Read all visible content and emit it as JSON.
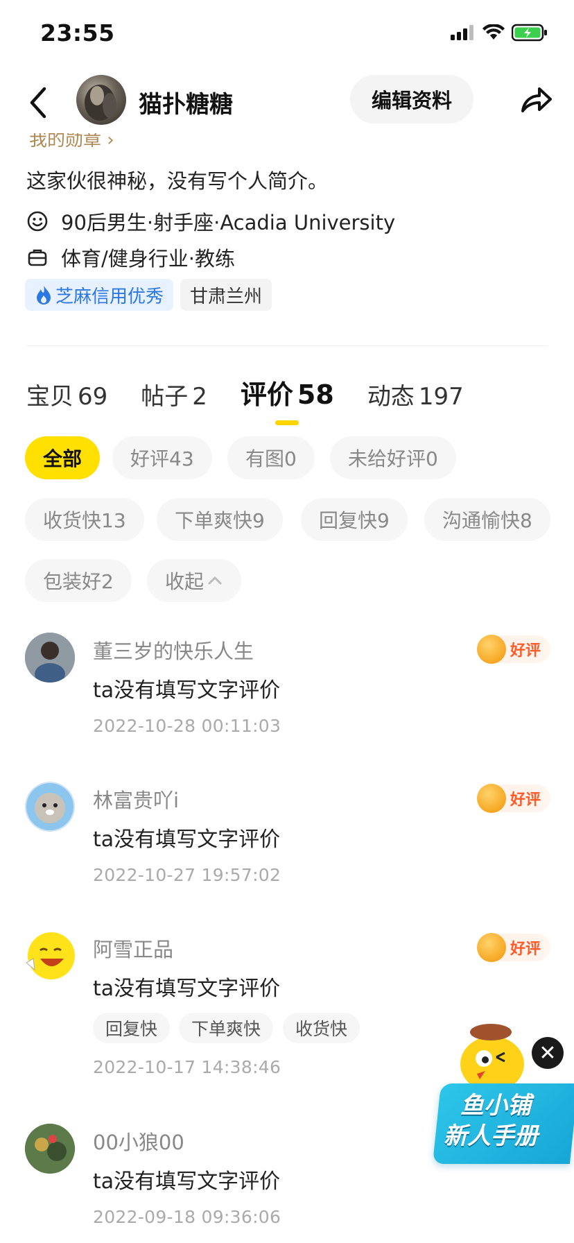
{
  "status_bar": {
    "time": "23:55"
  },
  "header": {
    "name": "猫扑糖糖",
    "edit_label": "编辑资料"
  },
  "profile": {
    "badge_partial": "我的勋章",
    "bio": "这家伙很神秘，没有写个人简介。",
    "info": [
      {
        "icon": "smile-icon",
        "text": "90后男生·射手座·Acadia University"
      },
      {
        "icon": "briefcase-icon",
        "text": "体育/健身行业·教练"
      }
    ],
    "tags": {
      "credit": "芝麻信用优秀",
      "location": "甘肃兰州"
    }
  },
  "tabs": [
    {
      "label": "宝贝",
      "count": "69"
    },
    {
      "label": "帖子",
      "count": "2"
    },
    {
      "label": "评价",
      "count": "58",
      "active": true
    },
    {
      "label": "动态",
      "count": "197"
    }
  ],
  "filters": [
    {
      "label": "全部",
      "active": true
    },
    {
      "label": "好评43"
    },
    {
      "label": "有图0"
    },
    {
      "label": "未给好评0"
    },
    {
      "label": "收货快13"
    },
    {
      "label": "下单爽快9"
    },
    {
      "label": "回复快9"
    },
    {
      "label": "沟通愉快8"
    },
    {
      "label": "包装好2"
    },
    {
      "label": "收起"
    }
  ],
  "reviews": [
    {
      "user": "董三岁的快乐人生",
      "text": "ta没有填写文字评价",
      "date": "2022-10-28 00:11:03",
      "rating": "好评",
      "tags": []
    },
    {
      "user": "林富贵吖i",
      "text": "ta没有填写文字评价",
      "date": "2022-10-27 19:57:02",
      "rating": "好评",
      "tags": []
    },
    {
      "user": "阿雪正品",
      "text": "ta没有填写文字评价",
      "date": "2022-10-17 14:38:46",
      "rating": "好评",
      "tags": [
        "回复快",
        "下单爽快",
        "收货快"
      ]
    },
    {
      "user": "00小狼00",
      "text": "ta没有填写文字评价",
      "date": "2022-09-18 09:36:06",
      "rating": "",
      "tags": []
    }
  ],
  "floating_widget": {
    "line1": "鱼小铺",
    "line2": "新人手册",
    "close": "✕"
  },
  "colors": {
    "accent_yellow": "#ffe000",
    "tab_underline": "#ffd500",
    "credit_blue": "#2b78e4",
    "good_badge_red": "#ff5a2a",
    "widget_blue": "#17a6d6"
  }
}
